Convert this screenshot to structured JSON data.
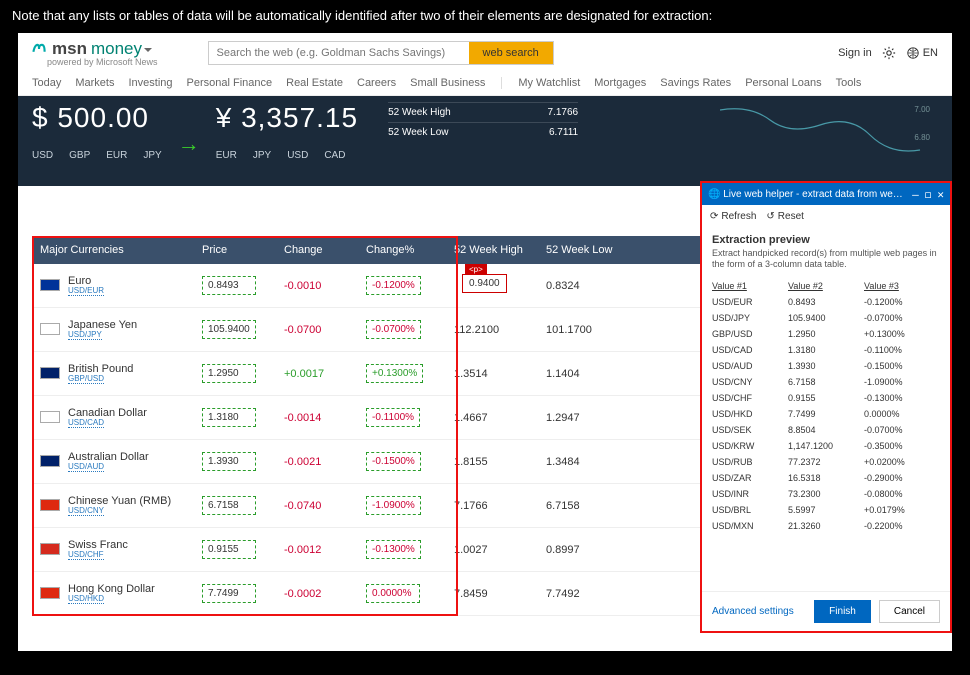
{
  "caption": "Note that any lists or tables of data will be automatically identified after two of their elements are designated for extraction:",
  "brand": {
    "logo": "msn",
    "section": "money",
    "powered": "powered by Microsoft News"
  },
  "search": {
    "placeholder": "Search the web (e.g. Goldman Sachs Savings)",
    "button": "web search"
  },
  "header": {
    "signin": "Sign in",
    "lang": "EN"
  },
  "nav": [
    "Today",
    "Markets",
    "Investing",
    "Personal Finance",
    "Real Estate",
    "Careers",
    "Small Business",
    "My Watchlist",
    "Mortgages",
    "Savings Rates",
    "Personal Loans",
    "Tools"
  ],
  "hero": {
    "left": {
      "currency": "$",
      "value": "500.00",
      "tabs": [
        "USD",
        "GBP",
        "EUR",
        "JPY"
      ]
    },
    "right": {
      "currency": "¥",
      "value": "3,357.15",
      "tabs": [
        "EUR",
        "JPY",
        "USD",
        "CAD"
      ]
    },
    "stats": [
      {
        "label": "52 Week High",
        "value": "7.1766"
      },
      {
        "label": "52 Week Low",
        "value": "6.7111"
      }
    ],
    "chart_ticks": [
      "7.00",
      "6.80"
    ]
  },
  "table": {
    "headers": [
      "Major Currencies",
      "Price",
      "Change",
      "Change%",
      "52 Week High",
      "52 Week Low"
    ],
    "ptag": "<p>",
    "pvalue": "0.9400",
    "rows": [
      {
        "flag": "#003399",
        "name": "Euro",
        "pair": "USD/EUR",
        "price": "0.8493",
        "change": "-0.0010",
        "changePct": "-0.1200%",
        "hi": "",
        "lo": "0.8324",
        "neg": true
      },
      {
        "flag": "#ffffff",
        "name": "Japanese Yen",
        "pair": "USD/JPY",
        "price": "105.9400",
        "change": "-0.0700",
        "changePct": "-0.0700%",
        "hi": "112.2100",
        "lo": "101.1700",
        "neg": true
      },
      {
        "flag": "#012169",
        "name": "British Pound",
        "pair": "GBP/USD",
        "price": "1.2950",
        "change": "+0.0017",
        "changePct": "+0.1300%",
        "hi": "1.3514",
        "lo": "1.1404",
        "neg": false
      },
      {
        "flag": "#ffffff",
        "name": "Canadian Dollar",
        "pair": "USD/CAD",
        "price": "1.3180",
        "change": "-0.0014",
        "changePct": "-0.1100%",
        "hi": "1.4667",
        "lo": "1.2947",
        "neg": true
      },
      {
        "flag": "#012169",
        "name": "Australian Dollar",
        "pair": "USD/AUD",
        "price": "1.3930",
        "change": "-0.0021",
        "changePct": "-0.1500%",
        "hi": "1.8155",
        "lo": "1.3484",
        "neg": true
      },
      {
        "flag": "#de2910",
        "name": "Chinese Yuan (RMB)",
        "pair": "USD/CNY",
        "price": "6.7158",
        "change": "-0.0740",
        "changePct": "-1.0900%",
        "hi": "7.1766",
        "lo": "6.7158",
        "neg": true
      },
      {
        "flag": "#d52b1e",
        "name": "Swiss Franc",
        "pair": "USD/CHF",
        "price": "0.9155",
        "change": "-0.0012",
        "changePct": "-0.1300%",
        "hi": "1.0027",
        "lo": "0.8997",
        "neg": true
      },
      {
        "flag": "#de2910",
        "name": "Hong Kong Dollar",
        "pair": "USD/HKD",
        "price": "7.7499",
        "change": "-0.0002",
        "changePct": "0.0000%",
        "hi": "7.8459",
        "lo": "7.7492",
        "neg": true
      }
    ]
  },
  "helper": {
    "title": "Live web helper - extract data from web...",
    "refresh": "Refresh",
    "reset": "Reset",
    "heading": "Extraction preview",
    "desc": "Extract handpicked record(s) from multiple web pages in the form of a 3-column data table.",
    "cols": [
      "Value #1",
      "Value #2",
      "Value #3"
    ],
    "rows": [
      [
        "USD/EUR",
        "0.8493",
        "-0.1200%"
      ],
      [
        "USD/JPY",
        "105.9400",
        "-0.0700%"
      ],
      [
        "GBP/USD",
        "1.2950",
        "+0.1300%"
      ],
      [
        "USD/CAD",
        "1.3180",
        "-0.1100%"
      ],
      [
        "USD/AUD",
        "1.3930",
        "-0.1500%"
      ],
      [
        "USD/CNY",
        "6.7158",
        "-1.0900%"
      ],
      [
        "USD/CHF",
        "0.9155",
        "-0.1300%"
      ],
      [
        "USD/HKD",
        "7.7499",
        "0.0000%"
      ],
      [
        "USD/SEK",
        "8.8504",
        "-0.0700%"
      ],
      [
        "USD/KRW",
        "1,147.1200",
        "-0.3500%"
      ],
      [
        "USD/RUB",
        "77.2372",
        "+0.0200%"
      ],
      [
        "USD/ZAR",
        "16.5318",
        "-0.2900%"
      ],
      [
        "USD/INR",
        "73.2300",
        "-0.0800%"
      ],
      [
        "USD/BRL",
        "5.5997",
        "+0.0179%"
      ],
      [
        "USD/MXN",
        "21.3260",
        "-0.2200%"
      ]
    ],
    "advanced": "Advanced settings",
    "finish": "Finish",
    "cancel": "Cancel"
  }
}
